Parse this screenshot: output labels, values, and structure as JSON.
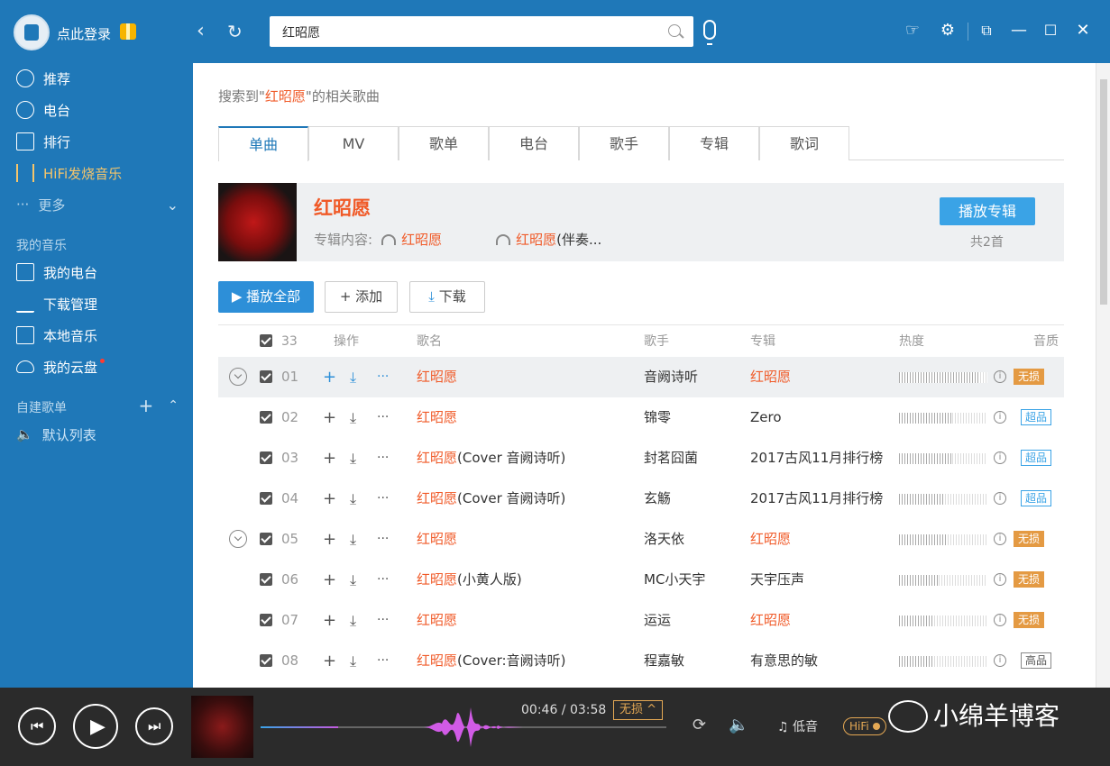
{
  "app": {
    "login_label": "点此登录"
  },
  "search": {
    "query": "红昭愿"
  },
  "sidebar": {
    "items": [
      {
        "label": "推荐"
      },
      {
        "label": "电台"
      },
      {
        "label": "排行"
      },
      {
        "label": "HiFi发烧音乐"
      },
      {
        "label": "更多"
      }
    ],
    "my_music_header": "我的音乐",
    "my_items": [
      {
        "label": "我的电台"
      },
      {
        "label": "下载管理"
      },
      {
        "label": "本地音乐"
      },
      {
        "label": "我的云盘"
      }
    ],
    "custom_header": "自建歌单",
    "custom_items": [
      {
        "label": "默认列表"
      }
    ]
  },
  "results": {
    "hint_prefix": "搜索到\"",
    "hint_keyword": "红昭愿",
    "hint_suffix": "\"的相关歌曲",
    "tabs": [
      "单曲",
      "MV",
      "歌单",
      "电台",
      "歌手",
      "专辑",
      "歌词"
    ],
    "active_tab": 0
  },
  "album": {
    "title": "红昭愿",
    "content_label": "专辑内容:",
    "track1": "红昭愿",
    "track2_hl": "红昭愿",
    "track2_rest": "(伴奏...",
    "play_label": "播放专辑",
    "count_label": "共2首"
  },
  "actions": {
    "play_all": "播放全部",
    "add": "添加",
    "download": "下载"
  },
  "table": {
    "count": "33",
    "headers": {
      "ops": "操作",
      "title": "歌名",
      "artist": "歌手",
      "album": "专辑",
      "heat": "热度",
      "quality": "音质"
    },
    "rows": [
      {
        "num": "01",
        "title_hl": "红昭愿",
        "title_rest": "",
        "artist": "音阙诗听",
        "album": "红昭愿",
        "album_hl": true,
        "heat": 0.92,
        "quality": "无损",
        "qtype": "lossless",
        "expandable": true,
        "hover": true
      },
      {
        "num": "02",
        "title_hl": "红昭愿",
        "title_rest": "",
        "artist": "锦零",
        "album": "Zero",
        "album_hl": false,
        "heat": 0.6,
        "quality": "超品",
        "qtype": "super",
        "expandable": false,
        "hover": false
      },
      {
        "num": "03",
        "title_hl": "红昭愿",
        "title_rest": "(Cover 音阙诗听)",
        "artist": "封茗囧菌",
        "album": "2017古风11月排行榜",
        "album_hl": false,
        "heat": 0.6,
        "quality": "超品",
        "qtype": "super",
        "expandable": false,
        "hover": false
      },
      {
        "num": "04",
        "title_hl": "红昭愿",
        "title_rest": "(Cover 音阙诗听)",
        "artist": "玄觞",
        "album": "2017古风11月排行榜",
        "album_hl": false,
        "heat": 0.52,
        "quality": "超品",
        "qtype": "super",
        "expandable": false,
        "hover": false
      },
      {
        "num": "05",
        "title_hl": "红昭愿",
        "title_rest": "",
        "artist": "洛天依",
        "album": "红昭愿",
        "album_hl": true,
        "heat": 0.55,
        "quality": "无损",
        "qtype": "lossless",
        "expandable": true,
        "hover": false
      },
      {
        "num": "06",
        "title_hl": "红昭愿",
        "title_rest": "(小黄人版)",
        "artist": "MC小天宇",
        "album": "天宇压声",
        "album_hl": false,
        "heat": 0.45,
        "quality": "无损",
        "qtype": "lossless",
        "expandable": false,
        "hover": false
      },
      {
        "num": "07",
        "title_hl": "红昭愿",
        "title_rest": "",
        "artist": "运运",
        "album": "红昭愿",
        "album_hl": true,
        "heat": 0.4,
        "quality": "无损",
        "qtype": "lossless",
        "expandable": false,
        "hover": false
      },
      {
        "num": "08",
        "title_hl": "红昭愿",
        "title_rest": "(Cover:音阙诗听)",
        "artist": "程嘉敏",
        "album": "有意思的敏",
        "album_hl": false,
        "heat": 0.4,
        "quality": "高品",
        "qtype": "high",
        "expandable": false,
        "hover": false
      }
    ]
  },
  "player": {
    "time": "00:46 / 03:58",
    "quality": "无损 ^",
    "bass": "低音",
    "hifi": "HiFi",
    "progress": 0.19,
    "watermark": "小绵羊博客"
  },
  "colors": {
    "brand": "#1f78b8",
    "highlight": "#f05a28",
    "accent": "#3aa3e6",
    "lossless": "#e49a43"
  }
}
